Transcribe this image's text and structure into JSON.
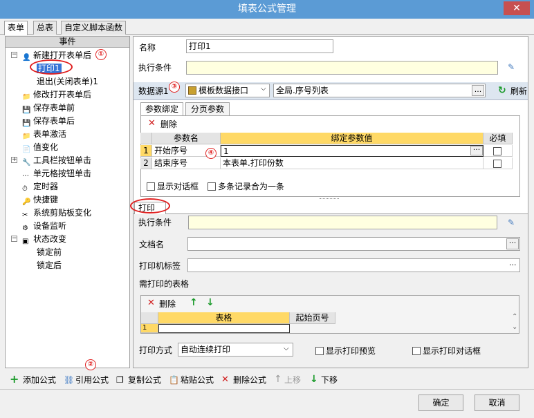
{
  "window": {
    "title": "填表公式管理",
    "close": "✕"
  },
  "tabs": [
    "表单",
    "总表",
    "自定义脚本函数"
  ],
  "events": {
    "header": "事件",
    "items": [
      {
        "label": "新建打开表单后",
        "level": 0,
        "expander": "−",
        "icon": "person"
      },
      {
        "label": "打印1",
        "level": 1,
        "selected": true
      },
      {
        "label": "退出(关闭表单)1",
        "level": 1
      },
      {
        "label": "修改打开表单后",
        "level": 0,
        "icon": "folder"
      },
      {
        "label": "保存表单前",
        "level": 0,
        "icon": "save"
      },
      {
        "label": "保存表单后",
        "level": 0,
        "icon": "save"
      },
      {
        "label": "表单激活",
        "level": 0,
        "icon": "folder"
      },
      {
        "label": "值变化",
        "level": 0,
        "icon": "doc"
      },
      {
        "label": "工具栏按钮单击",
        "level": 0,
        "expander": "+",
        "icon": "tool"
      },
      {
        "label": "单元格按钮单击",
        "level": 0,
        "icon": "dots"
      },
      {
        "label": "定时器",
        "level": 0,
        "icon": "timer"
      },
      {
        "label": "快捷键",
        "level": 0,
        "icon": "key"
      },
      {
        "label": "系统剪贴板变化",
        "level": 0,
        "icon": "scissors"
      },
      {
        "label": "设备监听",
        "level": 0,
        "icon": "device"
      },
      {
        "label": "状态改变",
        "level": 0,
        "expander": "−",
        "icon": "state"
      },
      {
        "label": "锁定前",
        "level": 1
      },
      {
        "label": "锁定后",
        "level": 1
      }
    ]
  },
  "form": {
    "name_label": "名称",
    "name_value": "打印1",
    "cond_label": "执行条件",
    "cond_value": "",
    "ds_label": "数据源1",
    "ds_combo": "模板数据接口",
    "ds_value": "全局.序号列表",
    "ds_browse": "...",
    "refresh": "刷新"
  },
  "paramtabs": [
    "参数绑定",
    "分页参数"
  ],
  "paramgrid": {
    "delete": "删除",
    "headers": [
      "参数名",
      "绑定参数值",
      "必填"
    ],
    "rows": [
      {
        "num": "1",
        "name": "开始序号",
        "value": "1"
      },
      {
        "num": "2",
        "name": "结束序号",
        "value": "本表单.打印份数"
      }
    ],
    "show_dialog": "显示对话框",
    "merge": "多条记录合为一条"
  },
  "print": {
    "tab": "打印",
    "cond_label": "执行条件",
    "doc_label": "文档名",
    "printer_label": "打印机标签",
    "tables_label": "需打印的表格",
    "delete": "删除",
    "headers": [
      "表格",
      "起始页号"
    ],
    "row_num": "1",
    "mode_label": "打印方式",
    "mode_value": "自动连续打印",
    "preview": "显示打印预览",
    "dialog": "显示打印对话框"
  },
  "toolbar": {
    "add": "添加公式",
    "ref": "引用公式",
    "copy": "复制公式",
    "paste": "粘贴公式",
    "del": "删除公式",
    "up": "上移",
    "down": "下移"
  },
  "buttons": {
    "ok": "确定",
    "cancel": "取消"
  },
  "annotations": [
    "①",
    "②",
    "③",
    "④"
  ]
}
